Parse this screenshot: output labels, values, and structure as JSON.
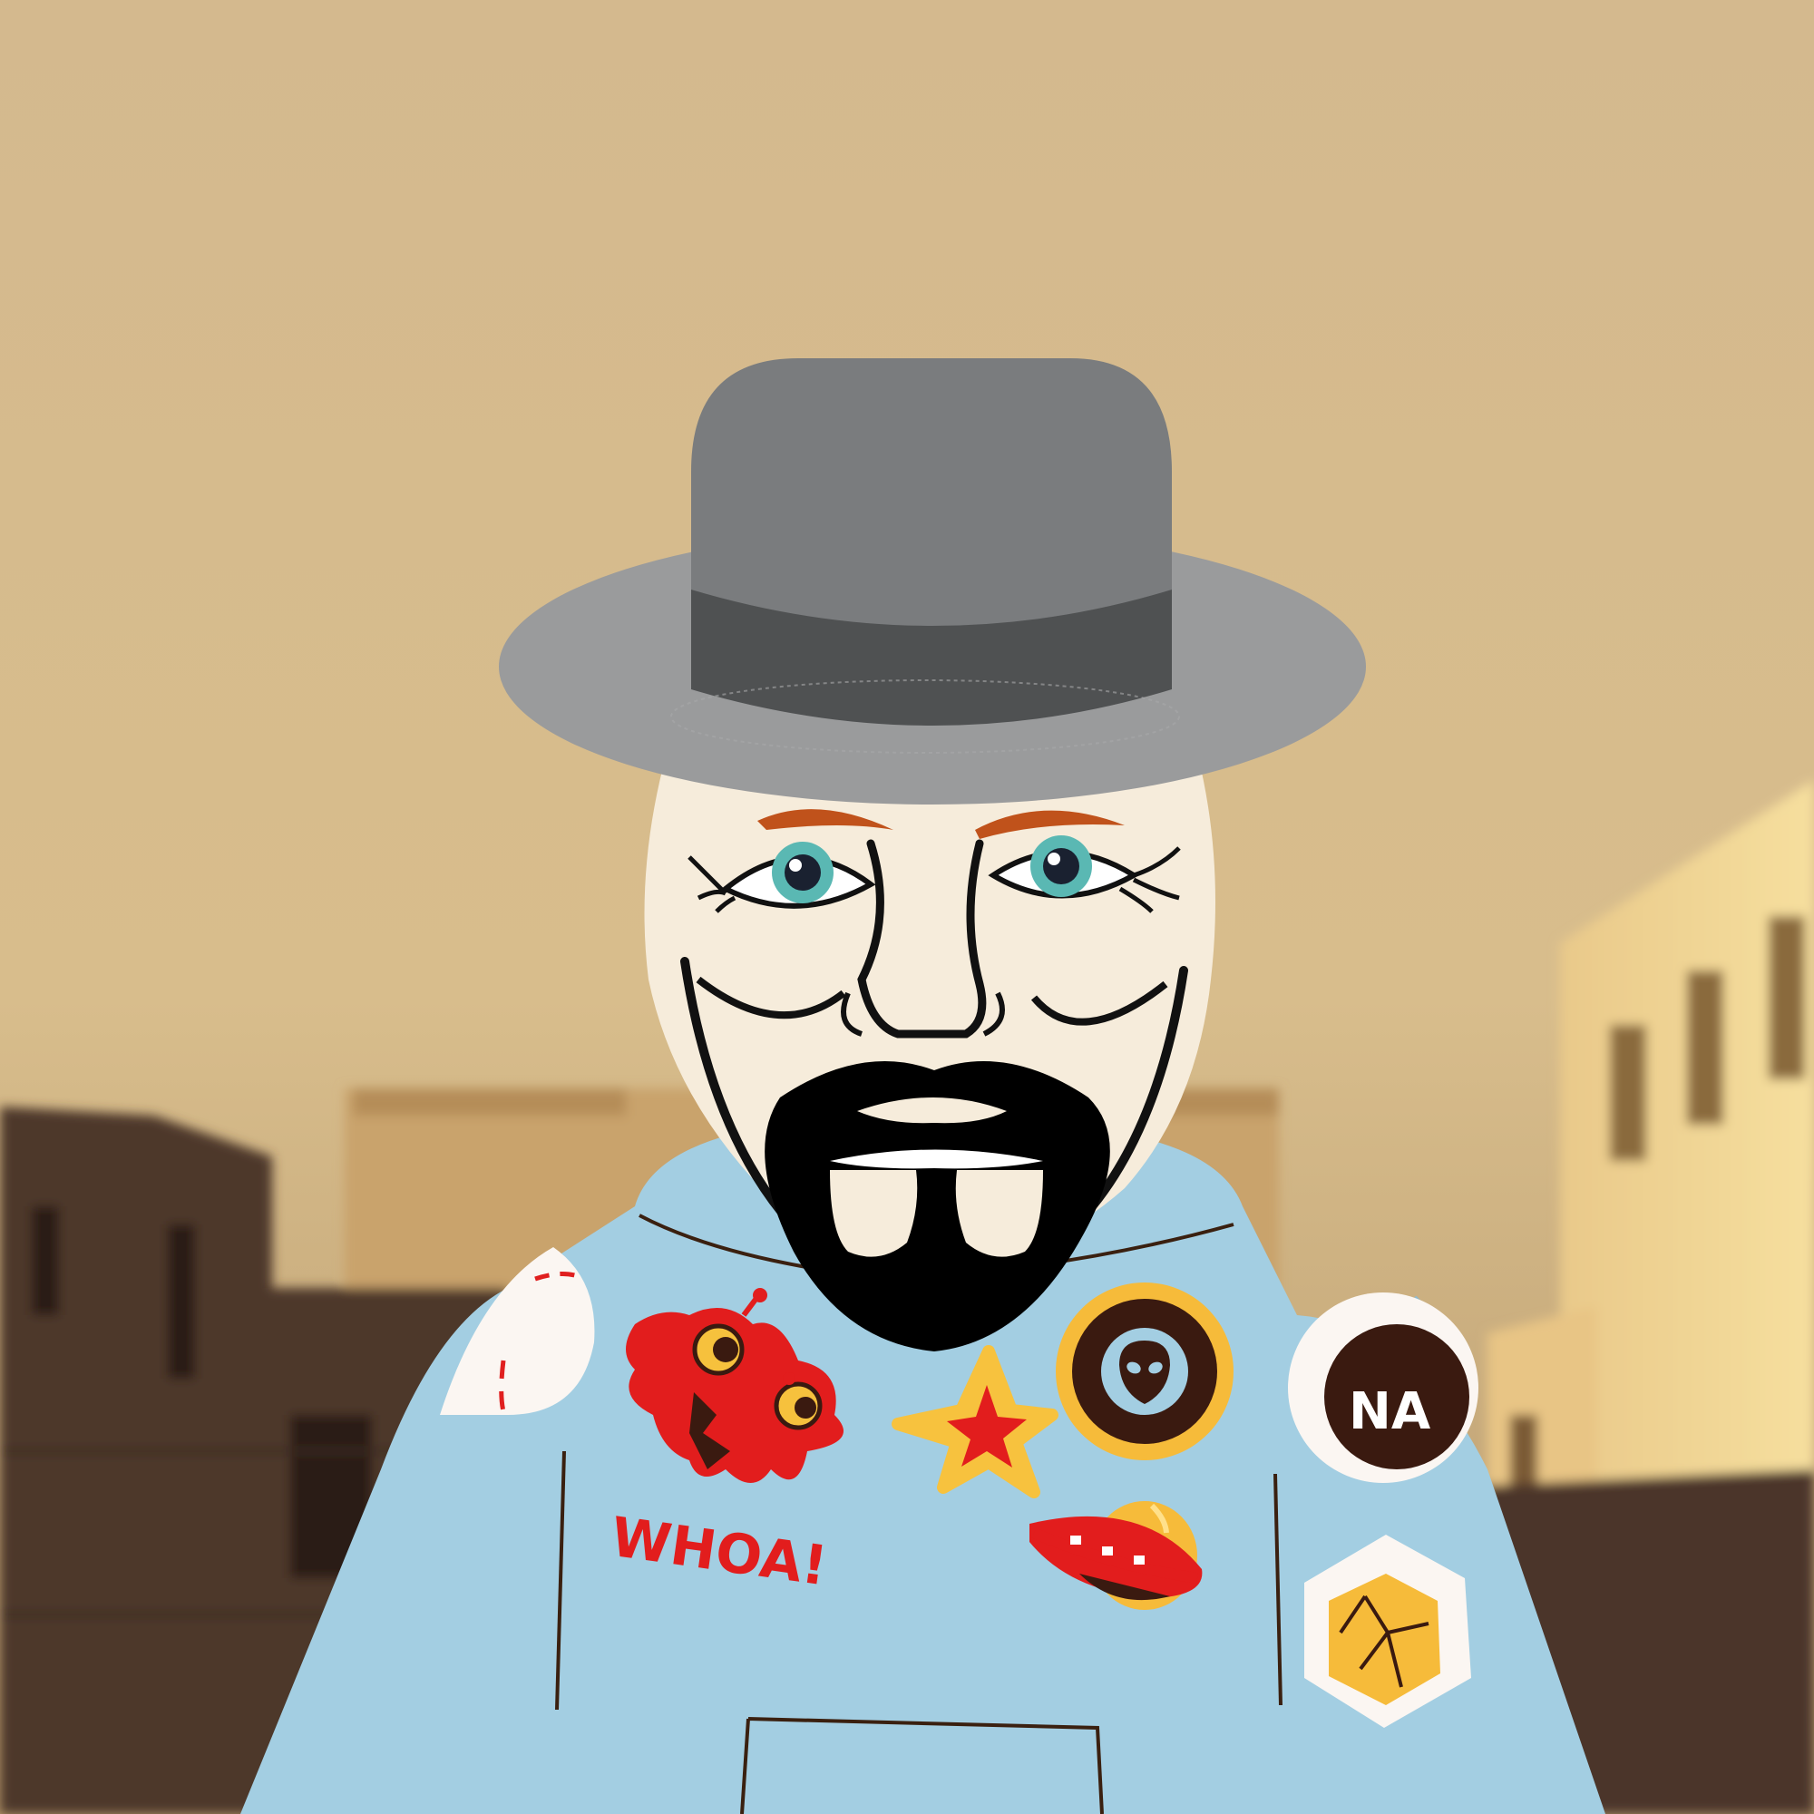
{
  "colors": {
    "sky": "#d6bc8f",
    "buildings_dark": "#4a362b",
    "buildings_light": "#efd59a",
    "hat": "#7a7c7e",
    "hat_band": "#4f5152",
    "hat_brim": "#9a9b9c",
    "face": "#f6ecdb",
    "hoodie": "#a3cee2",
    "beard": "#000000",
    "eyebrows": "#c0521b",
    "iris": "#5ab8b3"
  },
  "stickers": {
    "whoa_text": "WHOA!",
    "badge_text": "NA"
  },
  "icons": [
    "fedora-hat-icon",
    "mask-face-icon",
    "goatee-icon",
    "splat-monster-sticker-icon",
    "star-sticker-icon",
    "alien-badge-icon",
    "ufo-sticker-icon",
    "hexagon-sticker-icon",
    "circle-patch-icon"
  ]
}
